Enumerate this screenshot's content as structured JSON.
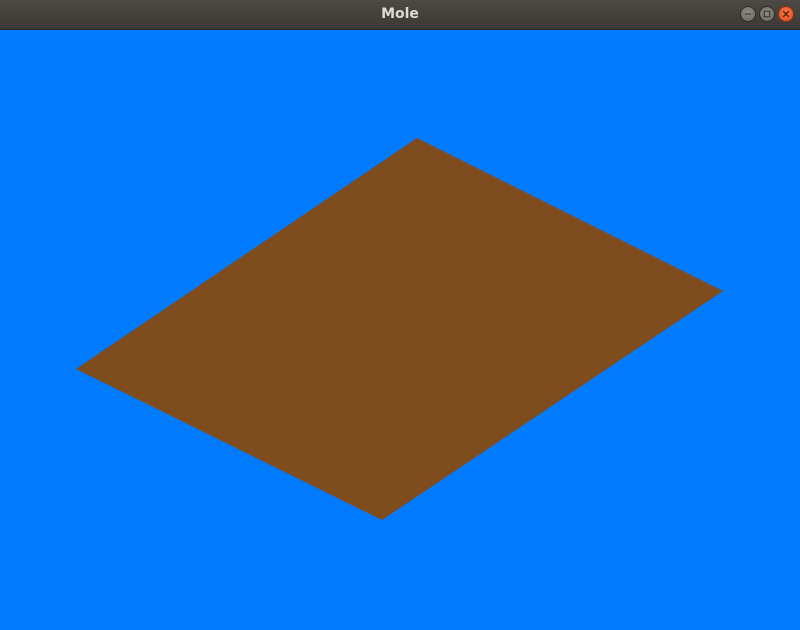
{
  "window": {
    "title": "Mole",
    "controls": {
      "minimize_icon": "minimize-icon",
      "maximize_icon": "maximize-icon",
      "close_icon": "close-icon"
    }
  },
  "scene": {
    "sky_color": "#007aff",
    "ground_color": "#7f4c1e"
  }
}
